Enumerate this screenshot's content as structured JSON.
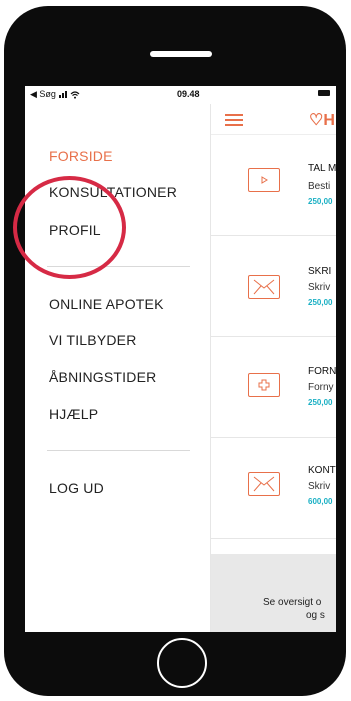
{
  "status": {
    "carrier": "◀ Søg",
    "time": "09.48"
  },
  "menu": {
    "items": [
      {
        "label": "FORSIDE",
        "active": true
      },
      {
        "label": "KONSULTATIONER",
        "active": false
      },
      {
        "label": "PROFIL",
        "active": false
      },
      {
        "label": "ONLINE APOTEK",
        "active": false
      },
      {
        "label": "VI TILBYDER",
        "active": false
      },
      {
        "label": "ÅBNINGSTIDER",
        "active": false
      },
      {
        "label": "HJÆLP",
        "active": false
      },
      {
        "label": "LOG UD",
        "active": false
      }
    ]
  },
  "content": {
    "header_text": "H",
    "cards": [
      {
        "icon": "play-video-icon",
        "title": "TAL M",
        "subtitle": "Besti",
        "price": "250,00"
      },
      {
        "icon": "envelope-icon",
        "title": "SKRI",
        "subtitle": "Skriv",
        "price": "250,00"
      },
      {
        "icon": "plus-cross-icon",
        "title": "FORN",
        "subtitle": "Forny",
        "price": "250,00"
      },
      {
        "icon": "envelope-icon",
        "title": "KONT",
        "subtitle": "Skriv",
        "price": "600,00"
      }
    ],
    "footer_line1": "Se oversigt o",
    "footer_line2": "og s"
  },
  "colors": {
    "accent": "#e8704a",
    "price": "#1ab0c4",
    "annotation": "#d62a45"
  }
}
